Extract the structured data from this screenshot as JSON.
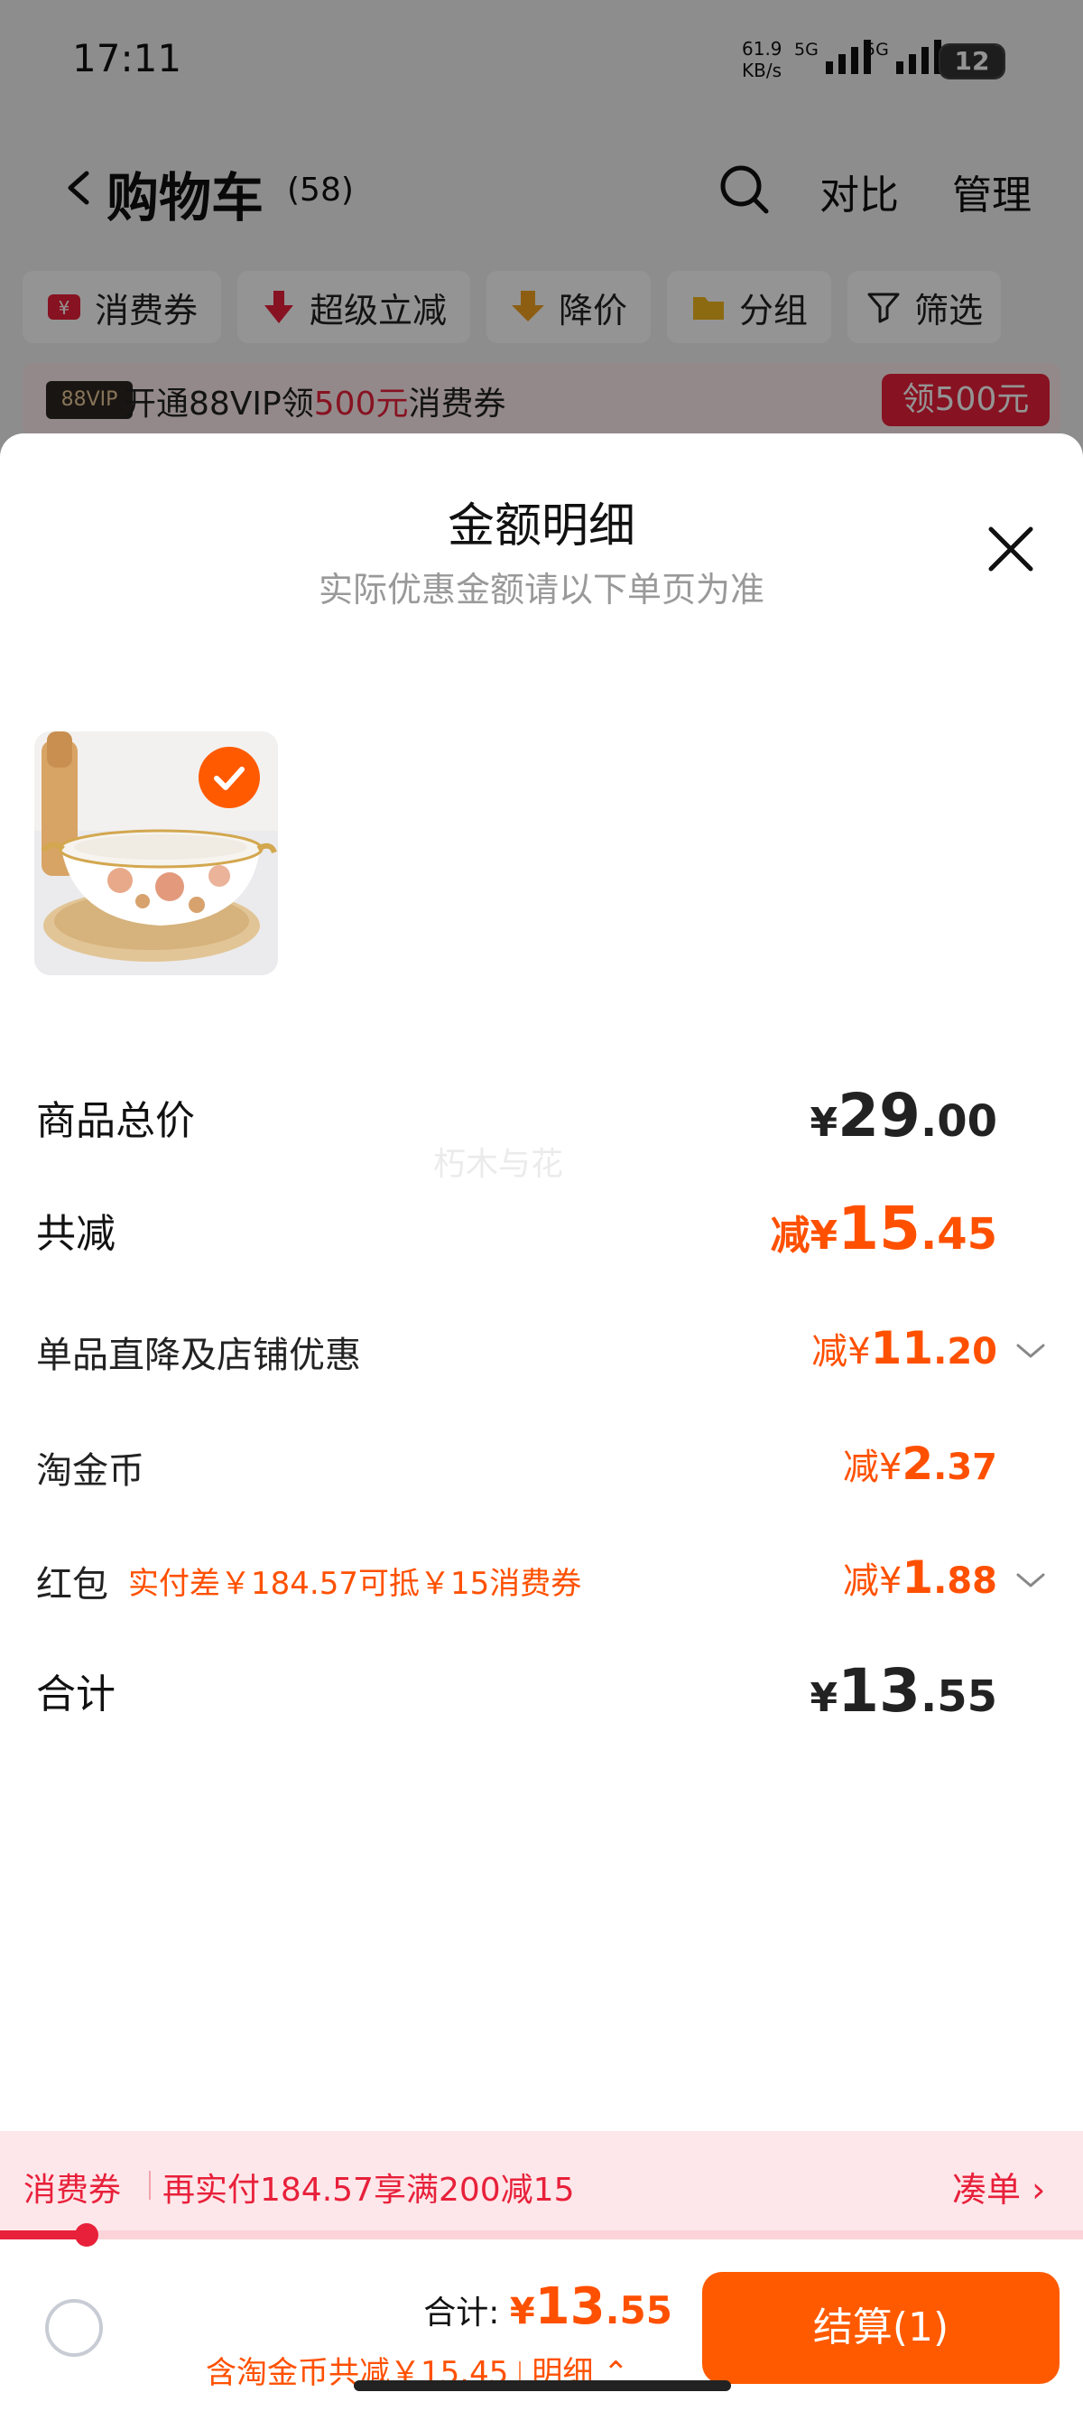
{
  "status_bar": {
    "time": "17:11",
    "net_speed_value": "61.9",
    "net_speed_unit": "KB/s",
    "sim1_label": "5G",
    "sim2_label": "5G",
    "battery": "12",
    "battery_color": "#e33333"
  },
  "nav": {
    "back_icon": "chevron-left-icon",
    "title": "购物车",
    "count": "(58)",
    "search_icon": "search-icon",
    "compare": "对比",
    "manage": "管理"
  },
  "chips": [
    {
      "label": "消费券",
      "icon": "coupon-icon"
    },
    {
      "label": "超级立减",
      "icon": "arrow-down-red-icon"
    },
    {
      "label": "降价",
      "icon": "arrow-down-yellow-icon"
    },
    {
      "label": "分组",
      "icon": "folder-icon"
    },
    {
      "label": "筛选",
      "icon": "filter-icon"
    }
  ],
  "vip_banner": {
    "badge": "88VIP",
    "text_before": "开通88VIP领",
    "text_highlight": "500元",
    "text_after": "消费券",
    "button": "领500元"
  },
  "sheet": {
    "title": "金额明细",
    "subtitle": "实际优惠金额请以下单页为准",
    "close_icon": "close-icon",
    "watermark": "朽木与花",
    "product": {
      "selected": true,
      "check_icon": "check-circle-icon"
    },
    "rows": {
      "total_price": {
        "label": "商品总价",
        "yen": "¥",
        "int": "29",
        "dec": ".00"
      },
      "total_discount": {
        "label": "共减",
        "prefix": "减",
        "yen": "¥",
        "int": "15",
        "dec": ".45"
      },
      "shop_discount": {
        "label": "单品直降及店铺优惠",
        "prefix": "减",
        "yen": "¥",
        "int": "11",
        "dec": ".20"
      },
      "coins": {
        "label": "淘金币",
        "prefix": "减",
        "yen": "¥",
        "int": "2",
        "dec": ".37"
      },
      "red_packet": {
        "label": "红包",
        "note": "实付差￥184.57可抵￥15消费券",
        "prefix": "减",
        "yen": "¥",
        "int": "1",
        "dec": ".88"
      },
      "sum": {
        "label": "合计",
        "yen": "¥",
        "int": "13",
        "dec": ".55"
      }
    }
  },
  "coupon_bar": {
    "label": "消费券",
    "text": "再实付184.57享满200减15",
    "link": "凑单 ›",
    "progress": 0.08
  },
  "bottom_bar": {
    "total_label": "合计: ",
    "yen": "¥",
    "int": "13",
    "dec": ".55",
    "detail_text": "含淘金币共减￥15.45",
    "detail_link": "明细 ⌃",
    "checkout": "结算(1)"
  },
  "colors": {
    "accent_orange": "#ff5000",
    "coupon_red": "#e8203a",
    "checkout_bg": "#ff5a00"
  }
}
